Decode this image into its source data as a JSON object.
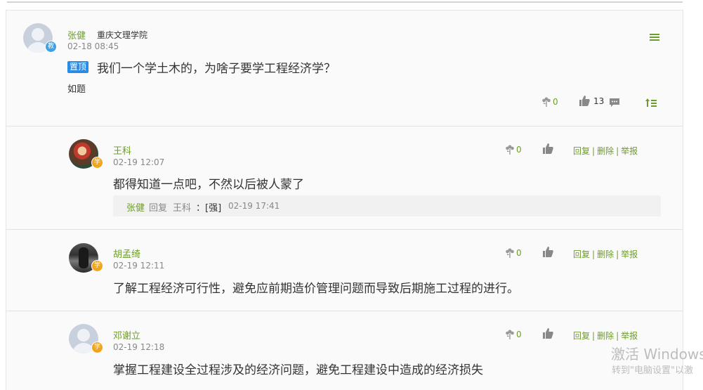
{
  "post": {
    "author": "张健",
    "school": "重庆文理学院",
    "role_badge": "教",
    "time": "02-18 08:45",
    "pin_label": "置顶",
    "title": "我们一个学土木的，为啥子要学工程经济学？",
    "body": "如题",
    "flowers": "0",
    "likes": "13"
  },
  "comments": [
    {
      "author": "王科",
      "role_badge": "学",
      "time": "02-19 12:07",
      "content": "都得知道一点吧，不然以后被人蒙了",
      "flowers": "0",
      "reply_label": "回复",
      "delete_label": "删除",
      "report_label": "举报",
      "sub_reply": {
        "author": "张健",
        "verb": "回复",
        "target": "王科",
        "content": "：[强]",
        "time": "02-19 17:41"
      }
    },
    {
      "author": "胡孟绮",
      "role_badge": "学",
      "time": "02-19 12:11",
      "content": "了解工程经济可行性，避免应前期造价管理问题而导致后期施工过程的进行。",
      "flowers": "0",
      "reply_label": "回复",
      "delete_label": "删除",
      "report_label": "举报"
    },
    {
      "author": "邓谢立",
      "role_badge": "学",
      "time": "02-19 12:18",
      "content": "掌握工程建设全过程涉及的经济问题，避免工程建设中造成的经济损失",
      "flowers": "0",
      "reply_label": "回复",
      "delete_label": "删除",
      "report_label": "举报"
    }
  ],
  "watermark": {
    "line1": "激活 Windows",
    "line2": "转到\"电脑设置\"以激"
  },
  "colors": {
    "accent_green": "#6e9c2a",
    "pin_blue": "#2b8ae3",
    "teacher_badge": "#3ea0e6",
    "student_badge": "#f2a51b"
  }
}
